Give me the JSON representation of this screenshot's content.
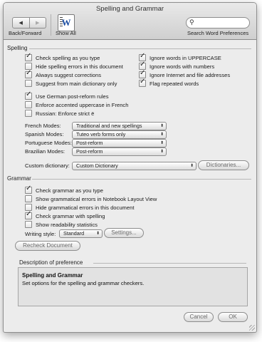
{
  "window": {
    "title": "Spelling and Grammar"
  },
  "toolbar": {
    "back_forward_label": "Back/Forward",
    "show_all_label": "Show All",
    "search_label": "Search Word Preferences",
    "search_value": "",
    "back_glyph": "◀",
    "forward_glyph": "▶"
  },
  "spelling": {
    "section_label": "Spelling",
    "left_options": [
      {
        "label": "Check spelling as you type",
        "checked": true
      },
      {
        "label": "Hide spelling errors in this document",
        "checked": false
      },
      {
        "label": "Always suggest corrections",
        "checked": true
      },
      {
        "label": "Suggest from main dictionary only",
        "checked": false
      }
    ],
    "right_options": [
      {
        "label": "Ignore words in UPPERCASE",
        "checked": true
      },
      {
        "label": "Ignore words with numbers",
        "checked": true
      },
      {
        "label": "Ignore Internet and file addresses",
        "checked": true
      },
      {
        "label": "Flag repeated words",
        "checked": true
      }
    ],
    "lang_options": [
      {
        "label": "Use German post-reform rules",
        "checked": true
      },
      {
        "label": "Enforce accented uppercase in French",
        "checked": false
      },
      {
        "label": "Russian: Enforce strict ë",
        "checked": false
      }
    ],
    "modes": [
      {
        "label": "French Modes:",
        "value": "Traditional and new spellings"
      },
      {
        "label": "Spanish Modes:",
        "value": "Tuteo verb forms only"
      },
      {
        "label": "Portuguese Modes:",
        "value": "Post-reform"
      },
      {
        "label": "Brazilian Modes:",
        "value": "Post-reform"
      }
    ],
    "custom_dictionary_label": "Custom dictionary:",
    "custom_dictionary_value": "Custom Dictionary",
    "dictionaries_button": "Dictionaries..."
  },
  "grammar": {
    "section_label": "Grammar",
    "options": [
      {
        "label": "Check grammar as you type",
        "checked": true
      },
      {
        "label": "Show grammatical errors in Notebook Layout View",
        "checked": false
      },
      {
        "label": "Hide grammatical errors in this document",
        "checked": false
      },
      {
        "label": "Check grammar with spelling",
        "checked": true
      },
      {
        "label": "Show readability statistics",
        "checked": false
      }
    ],
    "writing_style_label": "Writing style:",
    "writing_style_value": "Standard",
    "settings_button": "Settings...",
    "recheck_button": "Recheck Document"
  },
  "description": {
    "section_label": "Description of preference",
    "title": "Spelling and Grammar",
    "text": "Set options for the spelling and grammar checkers."
  },
  "footer": {
    "cancel_button": "Cancel",
    "ok_button": "OK"
  }
}
